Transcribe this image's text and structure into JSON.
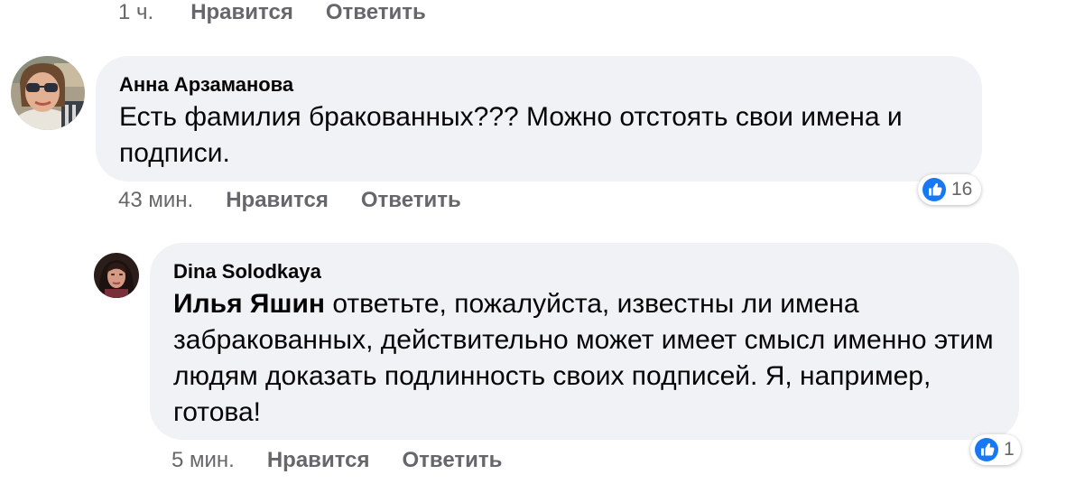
{
  "previous_comment": {
    "time": "1 ч.",
    "like_label": "Нравится",
    "reply_label": "Ответить"
  },
  "comments": [
    {
      "author": "Анна Арзаманова",
      "text": "Есть фамилия бракованных??? Можно отстоять свои имена и подписи.",
      "time": "43 мин.",
      "like_label": "Нравится",
      "reply_label": "Ответить",
      "reactions": {
        "icon": "like-icon",
        "count": "16"
      }
    },
    {
      "author": "Dina Solodkaya",
      "mention": "Илья Яшин",
      "text": " ответьте, пожалуйста, известны ли имена забракованных, действительно может имеет смысл именно этим людям доказать подлинность своих подписей. Я, например, готова!",
      "time": "5 мин.",
      "like_label": "Нравится",
      "reply_label": "Ответить",
      "reactions": {
        "icon": "like-icon",
        "count": "1"
      }
    }
  ],
  "colors": {
    "bubble": "#f0f2f5",
    "meta_text": "#65676b",
    "like_blue": "#1877f2"
  }
}
